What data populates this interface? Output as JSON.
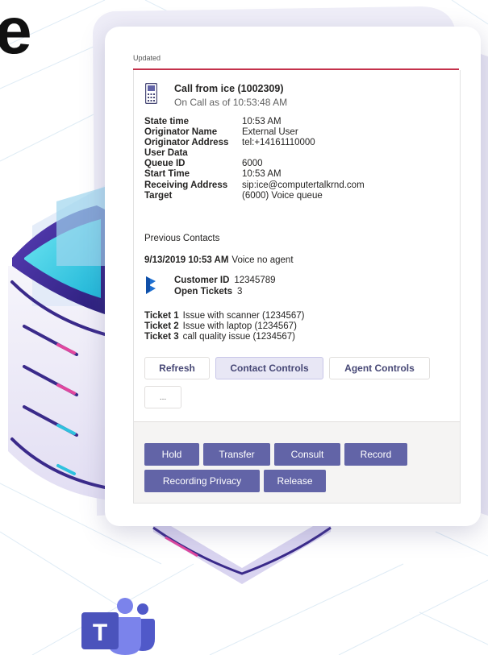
{
  "heading": {
    "text": "e"
  },
  "card": {
    "status_label": "Updated",
    "call": {
      "icon": "phone-icon",
      "title": "Call from ice (1002309)",
      "subtitle": "On Call as of 10:53:48 AM"
    },
    "details": [
      {
        "label": "State time",
        "value": "10:53 AM"
      },
      {
        "label": "Originator Name",
        "value": "External User"
      },
      {
        "label": "Originator Address",
        "value": "tel:+14161110000"
      },
      {
        "label": "User Data",
        "value": ""
      },
      {
        "label": "Queue ID",
        "value": "6000"
      },
      {
        "label": "Start Time",
        "value": "10:53 AM"
      },
      {
        "label": "Receiving Address",
        "value": "sip:ice@computertalkrnd.com"
      },
      {
        "label": "Target",
        "value": "(6000) Voice queue"
      }
    ],
    "previous_contacts_label": "Previous Contacts",
    "previous_contact": {
      "datetime": "9/13/2019 10:53 AM",
      "description": "Voice no agent"
    },
    "customer": {
      "icon": "dynamics-icon",
      "id_label": "Customer ID",
      "id_value": "12345789",
      "tickets_label": "Open Tickets",
      "tickets_value": "3"
    },
    "tickets": [
      {
        "label": "Ticket 1",
        "value": "Issue with scanner (1234567)"
      },
      {
        "label": "Ticket 2",
        "value": "Issue with laptop (1234567)"
      },
      {
        "label": "Ticket 3",
        "value": "call quality issue (1234567)"
      }
    ],
    "tabs": {
      "refresh": "Refresh",
      "contact_controls": "Contact Controls",
      "agent_controls": "Agent Controls",
      "more": "..."
    },
    "actions": {
      "hold": "Hold",
      "transfer": "Transfer",
      "consult": "Consult",
      "record": "Record",
      "recording_privacy": "Recording Privacy",
      "release": "Release"
    }
  },
  "colors": {
    "accent": "#6264a7",
    "accent_text": "#464775",
    "status_line": "#c4314b"
  },
  "logo": {
    "icon": "teams-logo-icon",
    "letter": "T"
  }
}
